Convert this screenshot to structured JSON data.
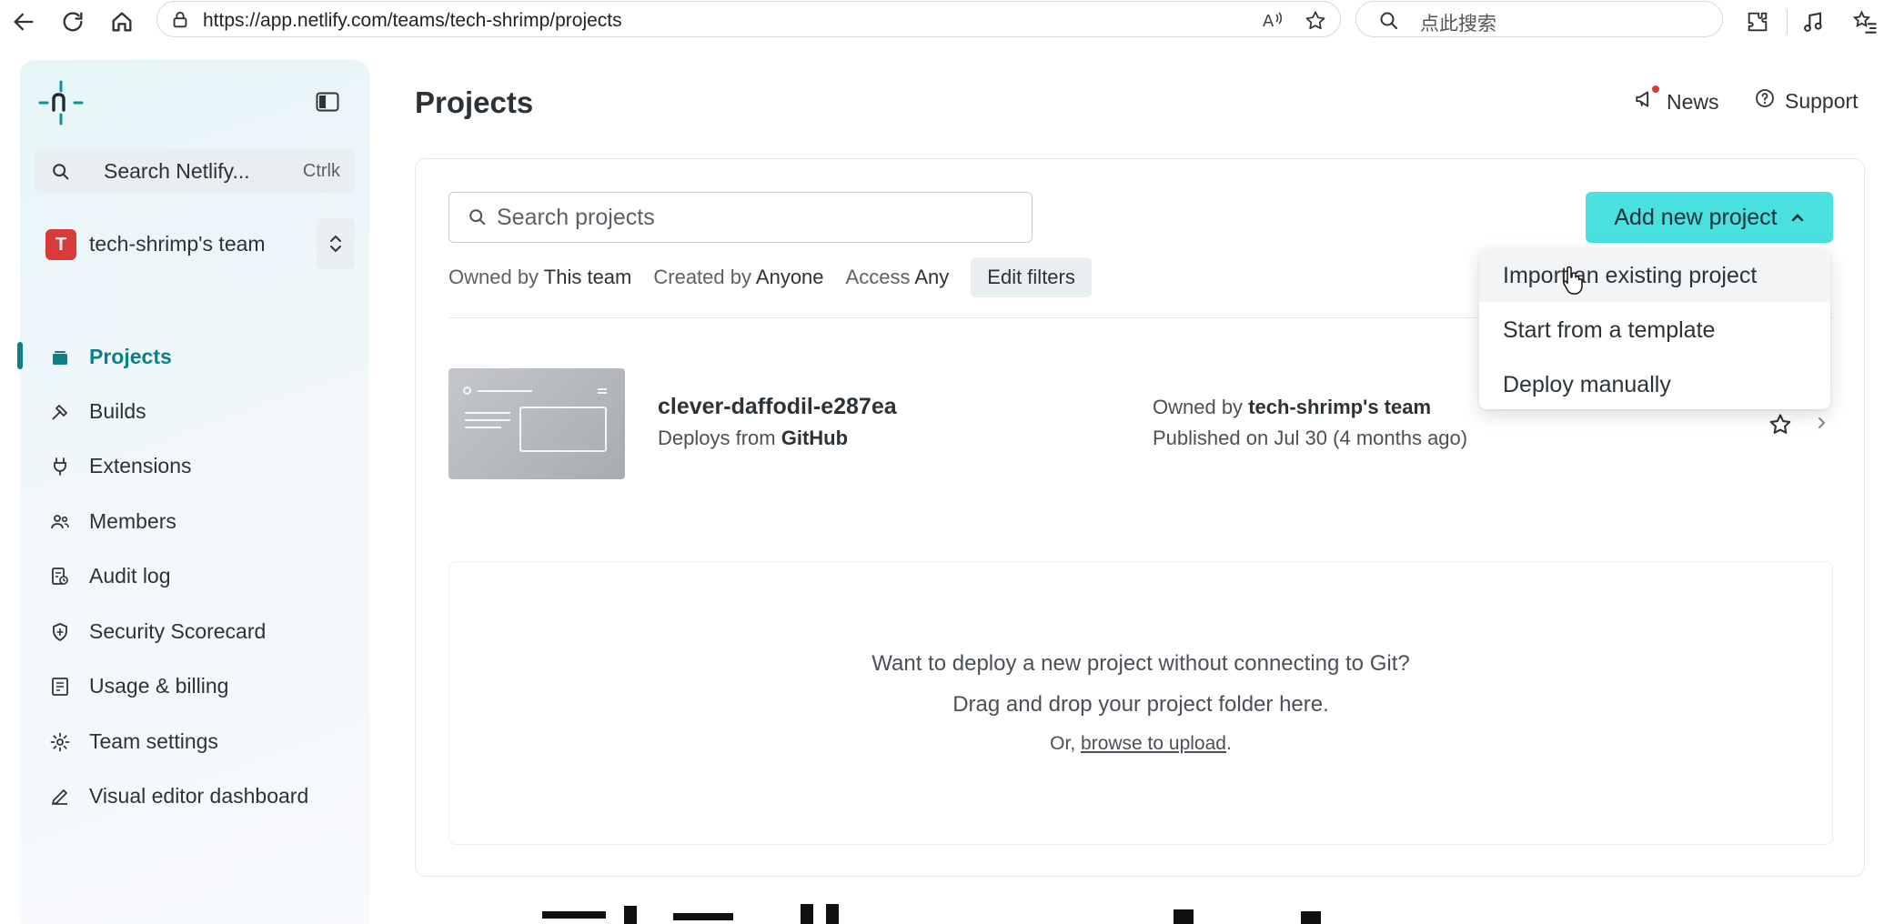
{
  "browser": {
    "url": "https://app.netlify.com/teams/tech-shrimp/projects",
    "search_placeholder": "点此搜索"
  },
  "sidebar": {
    "search_label": "Search Netlify...",
    "search_shortcut": "Ctrlk",
    "team_avatar_letter": "T",
    "team_name": "tech-shrimp's team",
    "items": [
      {
        "label": "Projects",
        "icon": "projects-icon",
        "active": true
      },
      {
        "label": "Builds",
        "icon": "builds-icon"
      },
      {
        "label": "Extensions",
        "icon": "extensions-icon"
      },
      {
        "label": "Members",
        "icon": "members-icon"
      },
      {
        "label": "Audit log",
        "icon": "audit-log-icon"
      },
      {
        "label": "Security Scorecard",
        "icon": "shield-icon"
      },
      {
        "label": "Usage & billing",
        "icon": "billing-icon"
      },
      {
        "label": "Team settings",
        "icon": "gear-icon"
      },
      {
        "label": "Visual editor dashboard",
        "icon": "pencil-icon"
      }
    ]
  },
  "header": {
    "title": "Projects",
    "news": "News",
    "support": "Support"
  },
  "toolbar": {
    "search_placeholder": "Search projects",
    "add_new_project": "Add new project",
    "filters": {
      "owned_label": "Owned by",
      "owned_value": "This team",
      "created_label": "Created by",
      "created_value": "Anyone",
      "access_label": "Access",
      "access_value": "Any",
      "edit": "Edit filters"
    }
  },
  "dropdown": {
    "items": [
      "Import an existing project",
      "Start from a template",
      "Deploy manually"
    ]
  },
  "project": {
    "name": "clever-daffodil-e287ea",
    "deploys_label": "Deploys from",
    "deploys_value": "GitHub",
    "owned_label": "Owned by",
    "owned_value": "tech-shrimp's team",
    "published": "Published on Jul 30 (4 months ago)"
  },
  "dropzone": {
    "line1": "Want to deploy a new project without connecting to Git?",
    "line2": "Drag and drop your project folder here.",
    "line3_prefix": "Or, ",
    "line3_link": "browse to upload",
    "line3_suffix": "."
  },
  "colors": {
    "accent": "#0f7f86",
    "button": "#4ae0e0",
    "avatar": "#d93a3a"
  }
}
